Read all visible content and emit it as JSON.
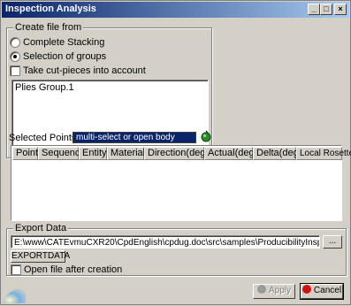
{
  "window": {
    "title": "Inspection Analysis"
  },
  "create_file_from": {
    "legend": "Create file from",
    "options": [
      {
        "label": "Complete Stacking",
        "selected": false
      },
      {
        "label": "Selection of groups",
        "selected": true
      }
    ],
    "cut_pieces_label": "Take cut-pieces into account",
    "cut_pieces_checked": false,
    "list_items": [
      "Plies Group.1"
    ]
  },
  "selected_points": {
    "label": "Selected Points:",
    "value": "multi-select or open body"
  },
  "table": {
    "columns": [
      "Point",
      "Sequence",
      "Entity",
      "Material",
      "Direction(deg)",
      "Actual(deg)",
      "Delta(deg)",
      "Local Rosette"
    ]
  },
  "export": {
    "legend": "Export Data",
    "path": "E:\\www\\CATEvmuCXR20\\CpdEnglish\\cpdug.doc\\src\\samples\\ProducibilityInspection.xls",
    "browse_label": "...",
    "export_button": "EXPORTDATA",
    "open_after_label": "Open file after creation",
    "open_after_checked": false
  },
  "footer": {
    "apply_label": "Apply",
    "cancel_label": "Cancel"
  },
  "colors": {
    "title_start": "#0a246a",
    "title_end": "#a6caf0",
    "face": "#d4d0c8",
    "selection": "#0a246a"
  }
}
